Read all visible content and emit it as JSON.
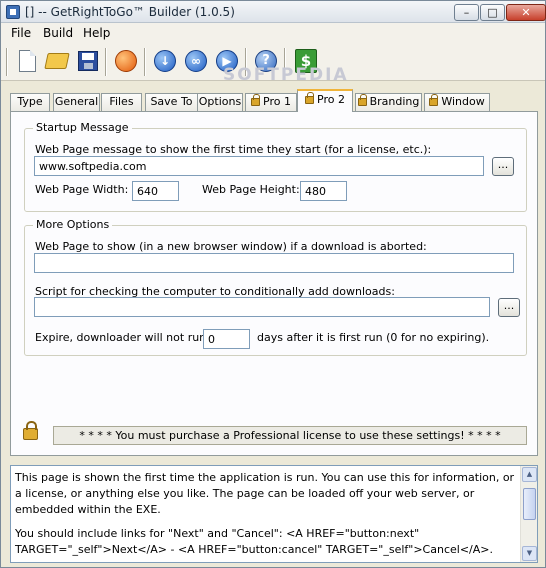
{
  "window": {
    "title": "[] -- GetRightToGo™ Builder (1.0.5)",
    "buttons": {
      "minimize": "–",
      "maximize": "□",
      "close": "✕"
    }
  },
  "menu": [
    "File",
    "Build",
    "Help"
  ],
  "toolbar": {
    "icons": [
      "new-file-icon",
      "open-folder-icon",
      "save-icon",
      "orange-action-icon",
      "download-arrow-icon",
      "link-icon",
      "play-icon",
      "help-icon",
      "dollar-icon"
    ],
    "help_glyph": "?",
    "buy_glyph": "$",
    "download_glyph": "↓",
    "link_glyph": "∞",
    "play_glyph": "▶"
  },
  "watermark": "SOFTPEDIA",
  "tabs": [
    {
      "label": "Type",
      "locked": false
    },
    {
      "label": "General",
      "locked": false
    },
    {
      "label": "Files",
      "locked": false
    },
    {
      "label": "Save To",
      "locked": false
    },
    {
      "label": "Options",
      "locked": false
    },
    {
      "label": "Pro 1",
      "locked": true
    },
    {
      "label": "Pro 2",
      "locked": true,
      "active": true
    },
    {
      "label": "Branding",
      "locked": true
    },
    {
      "label": "Window",
      "locked": true
    }
  ],
  "startup": {
    "title": "Startup Message",
    "msg_label": "Web Page message to show the first time they start (for a license, etc.):",
    "url": "www.softpedia.com",
    "browse": "...",
    "width_label": "Web Page Width:",
    "width": "640",
    "height_label": "Web Page Height:",
    "height": "480"
  },
  "more": {
    "title": "More Options",
    "abort_label": "Web Page to show (in a new browser window) if a download is aborted:",
    "abort_value": "",
    "script_label": "Script for checking the computer to conditionally add downloads:",
    "script_value": "",
    "browse": "...",
    "expire_label": "Expire, downloader will not run",
    "expire_value": "0",
    "expire_suffix": "days after it is first run (0 for no expiring)."
  },
  "notice": "* * * *  You must purchase a Professional license to use these settings!  * * * *",
  "help": {
    "p1": "This page is shown the first time the application is run.  You can use this for information, or a license, or anything else you like.  The page can be loaded off your web server, or embedded within the EXE.",
    "p2": "You should include links for \"Next\" and \"Cancel\":  <A HREF=\"button:next\" TARGET=\"_self\">Next</A> - <A HREF=\"button:cancel\" TARGET=\"_self\">Cancel</A>."
  }
}
